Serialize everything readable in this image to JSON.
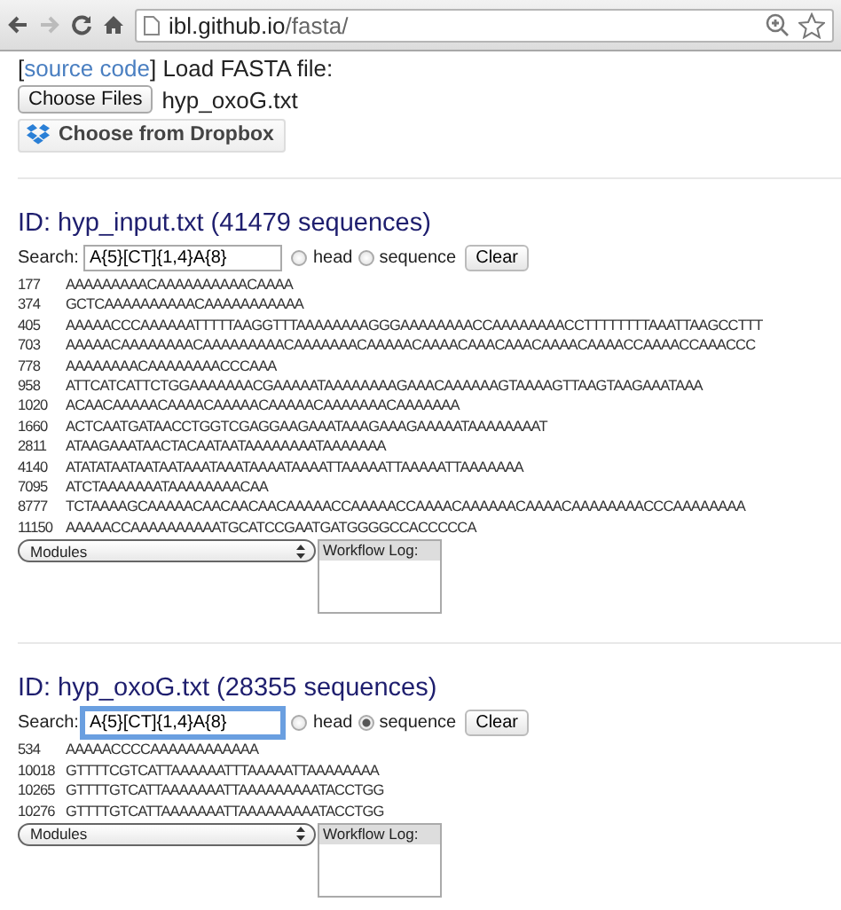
{
  "browser": {
    "url_host": "ibl.github.io",
    "url_path": "/fasta/"
  },
  "loader": {
    "open_bracket": "[",
    "link": "source code",
    "close_bracket": "]",
    "label": "Load FASTA file:",
    "file_button": "Choose Files",
    "file_name": "hyp_oxoG.txt",
    "dropbox_button": "Choose from Dropbox"
  },
  "datasets": [
    {
      "title": "ID: hyp_input.txt (41479 sequences)",
      "search_label": "Search:",
      "search_value": "A{5}[CT]{1,4}A{8}",
      "focused": false,
      "head_option": {
        "label": "head",
        "selected": false
      },
      "sequence_option": {
        "label": "sequence",
        "selected": false
      },
      "clear_button": "Clear",
      "rows": [
        {
          "id": "177",
          "seq": "AAAAAAAAACAAAAAAAAAACAAAA"
        },
        {
          "id": "374",
          "seq": "GCTCAAAAAAAAAACAAAAAAAAAAA"
        },
        {
          "id": "405",
          "seq": "AAAAACCCAAAAAATTTTTAAGGTTTAAAAAAAAGGGAAAAAAAACCAAAAAAAACCTTTTTTTTAAATTAAGCCTTT"
        },
        {
          "id": "703",
          "seq": "AAAAACAAAAAAAACAAAAAAAAACAAAAAAACAAAAACAAAACAAACAAACAAAACAAAACCAAAACCAAACCC"
        },
        {
          "id": "778",
          "seq": "AAAAAAAACAAAAAAAACCCAAA"
        },
        {
          "id": "958",
          "seq": "ATTCATCATTCTGGAAAAAAACGAAAAATAAAAAAAAGAAACAAAAAAGTAAAAGTTAAGTAAGAAATAAA"
        },
        {
          "id": "1020",
          "seq": "ACAACAAAAACAAAACAAAAACAAAAACAAAAAAACAAAAAAA"
        },
        {
          "id": "1660",
          "seq": "ACTCAATGATAACCTGGTCGAGGAAGAAATAAAGAAAGAAAAATAAAAAAAAT"
        },
        {
          "id": "2811",
          "seq": "ATAAGAAATAACTACAATAATAAAAAAAATAAAAAAA"
        },
        {
          "id": "4140",
          "seq": "ATATATAATAATAATAAATAAATAAAATAAAATTAAAAATTAAAAATTAAAAAAA"
        },
        {
          "id": "7095",
          "seq": "ATCTAAAAAAATAAAAAAAACAA"
        },
        {
          "id": "8777",
          "seq": "TCTAAAAGCAAAAACAACAACAACAAAAACCAAAAACCAAAACAAAAAACAAAACAAAAAAAACCCAAAAAAAA"
        },
        {
          "id": "11150",
          "seq": "AAAAACCAAAAAAAAAATGCATCCGAATGATGGGGCCACCCCCA"
        }
      ],
      "modules": "Modules",
      "log_title": "Workflow Log:"
    },
    {
      "title": "ID: hyp_oxoG.txt (28355 sequences)",
      "search_label": "Search:",
      "search_value": "A{5}[CT]{1,4}A{8}",
      "focused": true,
      "head_option": {
        "label": "head",
        "selected": false
      },
      "sequence_option": {
        "label": "sequence",
        "selected": true
      },
      "clear_button": "Clear",
      "rows": [
        {
          "id": "534",
          "seq": "AAAAACCCCAAAAAAAAAAAA"
        },
        {
          "id": "10018",
          "seq": "GTTTTCGTCATTAAAAAATTTAAAAATTAAAAAAAA"
        },
        {
          "id": "10265",
          "seq": "GTTTTGTCATTAAAAAAATTAAAAAAAAATACCTGG"
        },
        {
          "id": "10276",
          "seq": "GTTTTGTCATTAAAAAAATTAAAAAAAAATACCTGG"
        }
      ],
      "modules": "Modules",
      "log_title": "Workflow Log:"
    }
  ]
}
